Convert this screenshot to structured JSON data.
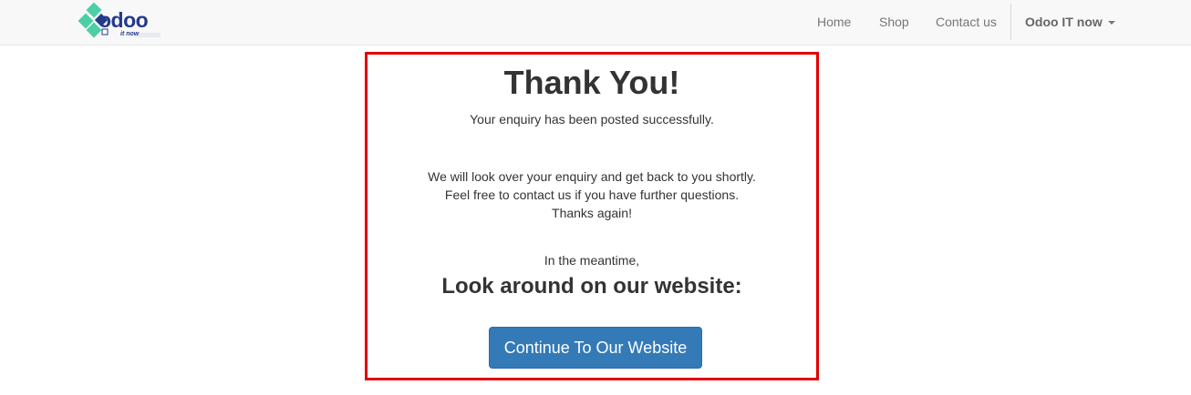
{
  "header": {
    "logo": {
      "text": "odoo",
      "subtext": "it now"
    },
    "nav": [
      {
        "label": "Home"
      },
      {
        "label": "Shop"
      },
      {
        "label": "Contact us"
      }
    ],
    "account_label": "Odoo IT now"
  },
  "main": {
    "title": "Thank You!",
    "subtitle": "Your enquiry has been posted successfully.",
    "message_lines": [
      "We will look over your enquiry and get back to you shortly.",
      "Feel free to contact us if you have further questions.",
      "Thanks again!"
    ],
    "meantime": "In the meantime,",
    "look_around": "Look around on our website:",
    "button_label": "Continue To Our Website"
  },
  "colors": {
    "accent": "#337ab7",
    "panel_border": "#e00000",
    "logo_text": "#233a8a",
    "logo_tiles": "#4ccfa6"
  }
}
